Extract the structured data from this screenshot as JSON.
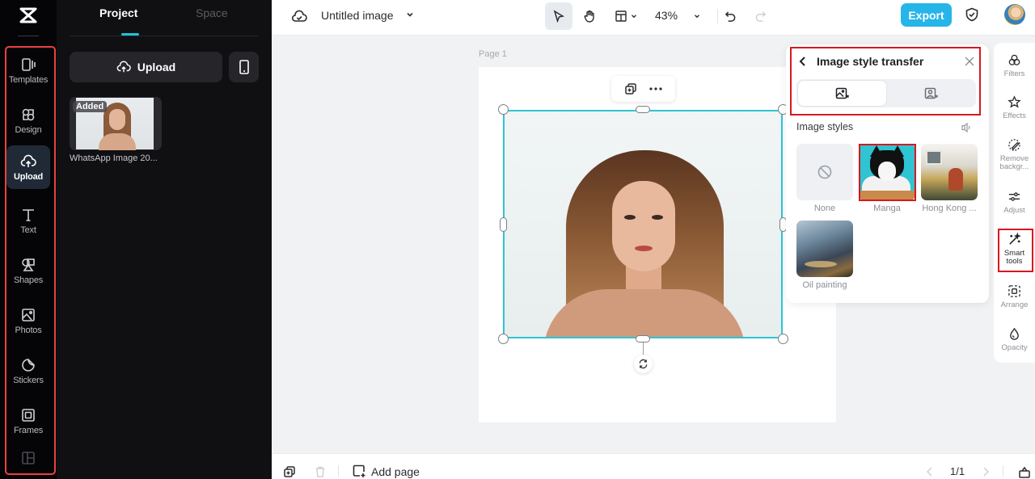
{
  "app": {
    "logo": "capcut-logo-icon"
  },
  "rail": {
    "items": [
      {
        "label": "Templates",
        "icon": "templates-icon"
      },
      {
        "label": "Design",
        "icon": "design-icon"
      },
      {
        "label": "Upload",
        "icon": "upload-cloud-icon",
        "active": true
      },
      {
        "label": "Text",
        "icon": "text-icon"
      },
      {
        "label": "Shapes",
        "icon": "shapes-icon"
      },
      {
        "label": "Photos",
        "icon": "photos-icon"
      },
      {
        "label": "Stickers",
        "icon": "stickers-icon"
      },
      {
        "label": "Frames",
        "icon": "frames-icon"
      }
    ]
  },
  "panel": {
    "tabs": [
      {
        "label": "Project",
        "active": true
      },
      {
        "label": "Space",
        "active": false
      }
    ],
    "upload_label": "Upload",
    "assets": [
      {
        "name": "WhatsApp Image 20...",
        "badge": "Added"
      }
    ]
  },
  "topbar": {
    "title": "Untitled image",
    "zoom": "43%",
    "export_label": "Export"
  },
  "canvas": {
    "page_label": "Page 1"
  },
  "style_panel": {
    "title": "Image style transfer",
    "section_title": "Image styles",
    "styles": [
      {
        "label": "None"
      },
      {
        "label": "Manga",
        "selected": true
      },
      {
        "label": "Hong Kong ..."
      },
      {
        "label": "Oil painting"
      }
    ]
  },
  "tools": {
    "items": [
      {
        "label": "Filters",
        "icon": "filters-icon"
      },
      {
        "label": "Effects",
        "icon": "effects-icon"
      },
      {
        "label": "Remove backgr...",
        "icon": "remove-background-icon"
      },
      {
        "label": "Adjust",
        "icon": "adjust-icon"
      },
      {
        "label": "Smart tools",
        "icon": "smart-tools-icon",
        "active": true
      },
      {
        "label": "Arrange",
        "icon": "arrange-icon"
      },
      {
        "label": "Opacity",
        "icon": "opacity-icon"
      }
    ]
  },
  "bottombar": {
    "add_page_label": "Add page",
    "page_indicator": "1/1"
  },
  "colors": {
    "accent": "#1fc3d6",
    "export": "#26b5e8",
    "highlight": "#d7181f",
    "rail_bg": "#050507",
    "panel_bg": "#101013"
  }
}
